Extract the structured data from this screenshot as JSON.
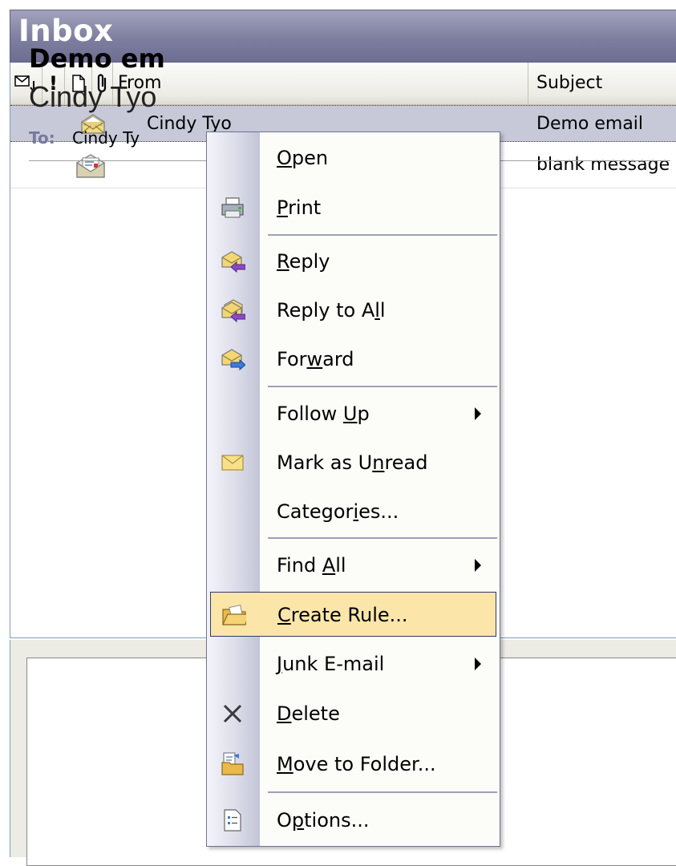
{
  "inbox": {
    "title": "Inbox"
  },
  "columns": {
    "importance_glyph": "!",
    "from_label": "From",
    "subject_label": "Subject"
  },
  "messages": [
    {
      "from": "Cindy Tyo",
      "subject": "Demo email",
      "icon": "envelope-open-icon",
      "selected": true
    },
    {
      "from": "",
      "subject": "blank message",
      "icon": "envelope-doc-icon",
      "selected": false
    }
  ],
  "reading_pane": {
    "subject": "Demo em",
    "from": "Cindy Tyo",
    "to_label": "To:",
    "to_value": "Cindy Ty"
  },
  "context_menu": {
    "items": [
      {
        "pre": "",
        "key": "O",
        "post": "pen",
        "icon": ""
      },
      {
        "pre": "",
        "key": "P",
        "post": "rint",
        "icon": "printer-icon"
      },
      {
        "pre": "",
        "key": "R",
        "post": "eply",
        "icon": "reply-icon"
      },
      {
        "pre": "Reply to A",
        "key": "l",
        "post": "l",
        "icon": "reply-all-icon"
      },
      {
        "pre": "For",
        "key": "w",
        "post": "ard",
        "icon": "forward-icon"
      },
      {
        "pre": "Follow ",
        "key": "U",
        "post": "p",
        "icon": "",
        "submenu": true
      },
      {
        "pre": "Mark as U",
        "key": "n",
        "post": "read",
        "icon": "envelope-closed-icon"
      },
      {
        "pre": "Categor",
        "key": "i",
        "post": "es...",
        "icon": ""
      },
      {
        "pre": "Find ",
        "key": "A",
        "post": "ll",
        "icon": "",
        "submenu": true
      },
      {
        "pre": "",
        "key": "C",
        "post": "reate Rule...",
        "icon": "create-rule-icon",
        "highlighted": true
      },
      {
        "pre": "",
        "key": "J",
        "post": "unk E-mail",
        "icon": "",
        "submenu": true
      },
      {
        "pre": "",
        "key": "D",
        "post": "elete",
        "icon": "delete-icon"
      },
      {
        "pre": "",
        "key": "M",
        "post": "ove to Folder...",
        "icon": "move-to-folder-icon"
      },
      {
        "pre": "O",
        "key": "p",
        "post": "tions...",
        "icon": "options-icon"
      }
    ]
  },
  "colors": {
    "header_gradient": "#7e7ea0",
    "selected_row": "#c7c9d8",
    "menu_highlight": "#fbe5a9",
    "menu_border": "#6f7395",
    "to_label": "#7779a0"
  }
}
